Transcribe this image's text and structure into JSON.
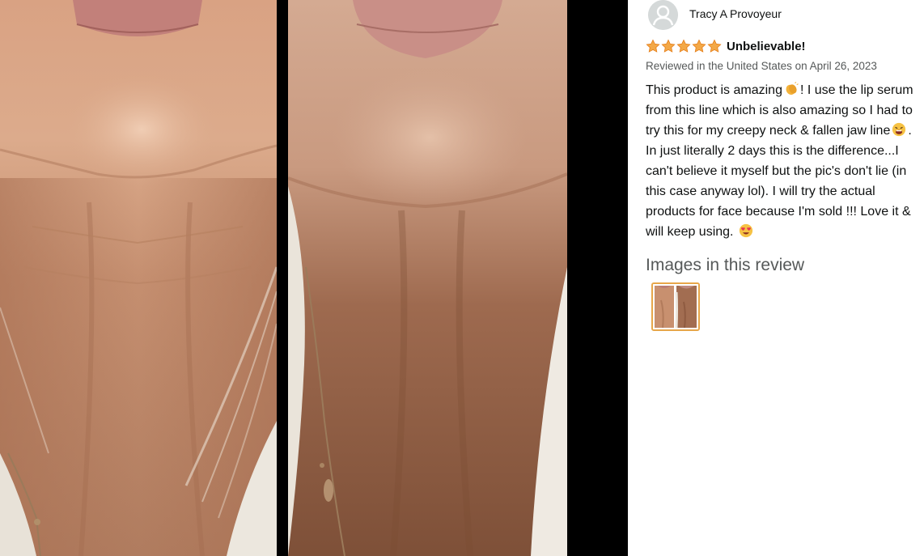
{
  "viewer": {
    "before_photo": "neck-before-photo",
    "after_photo": "neck-after-photo"
  },
  "review": {
    "reviewer_name": "Tracy A Provoyeur",
    "rating": 5,
    "rating_max": 5,
    "title": "Unbelievable!",
    "meta": "Reviewed in the United States on April 26, 2023",
    "body": {
      "part1": "This product is amazing",
      "emoji1": "clapping-hands-emoji",
      "part2": "! I use the lip serum from this line which is also amazing so I had to try this for my creepy neck & fallen jaw line",
      "emoji2": "tired-face-emoji",
      "part3": ". In just literally 2 days this is the difference...I can't believe it myself but the pic's don't lie (in this case anyway lol). I will try the actual products for face because I'm sold !!! Love it & will keep using.",
      "emoji3": "heart-eyes-emoji"
    },
    "images_heading": "Images in this review",
    "thumbnail": "review-image-thumbnail"
  },
  "colors": {
    "star": "#f3a847",
    "star_outline": "#e47911",
    "thumb_border": "#e7a64a",
    "meta_text": "#565959",
    "viewer_bg": "#000000"
  }
}
